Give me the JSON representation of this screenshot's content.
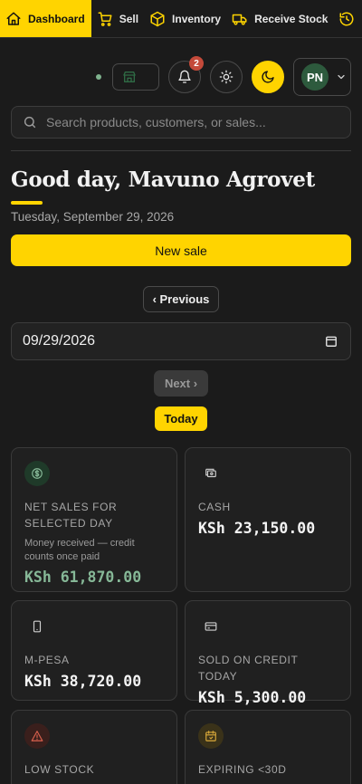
{
  "nav": {
    "items": [
      {
        "label": "Dashboard",
        "icon": "home-icon",
        "active": true
      },
      {
        "label": "Sell",
        "icon": "cart-icon"
      },
      {
        "label": "Inventory",
        "icon": "box-icon"
      },
      {
        "label": "Receive Stock",
        "icon": "truck-icon"
      }
    ]
  },
  "toolbar": {
    "notification_count": "2",
    "avatar_initials": "PN"
  },
  "search": {
    "placeholder": "Search products, customers, or sales..."
  },
  "greeting": {
    "title": "Good day, Mavuno Agrovet",
    "date": "Tuesday, September 29, 2026"
  },
  "actions": {
    "new_sale": "New sale",
    "previous": "‹ Previous",
    "date_value": "09/29/2026",
    "next": "Next ›",
    "today": "Today"
  },
  "cards": [
    {
      "label": "NET SALES FOR SELECTED DAY",
      "sub": "Money received — credit counts once paid",
      "value": "KSh 61,870.00",
      "icon": "dollar-circle-icon"
    },
    {
      "label": "CASH",
      "value": "KSh 23,150.00",
      "icon": "cash-icon"
    },
    {
      "label": "M-PESA",
      "value": "KSh 38,720.00",
      "icon": "phone-icon"
    },
    {
      "label": "SOLD ON CREDIT TODAY",
      "value": "KSh 5,300.00",
      "icon": "credit-card-icon"
    },
    {
      "label": "LOW STOCK",
      "icon": "warning-icon"
    },
    {
      "label": "EXPIRING <30D",
      "icon": "calendar-icon"
    }
  ],
  "colors": {
    "accent": "#ffd400",
    "background": "#1b1b1b",
    "positive": "#86b897",
    "alert": "#c44a3a"
  }
}
